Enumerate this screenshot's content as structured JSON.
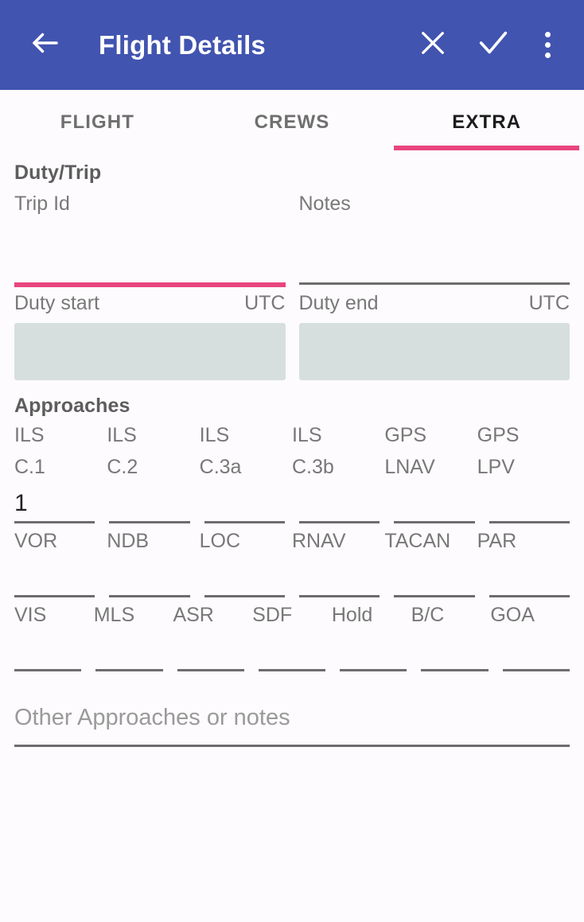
{
  "colors": {
    "appbar": "#4154b0",
    "accent_pink": "#e8457e",
    "background": "#fdfbfd",
    "date_box": "#d6dfde",
    "underline": "#6d6d6d",
    "label_text": "#787878",
    "section_title": "#5d5d5d"
  },
  "appbar": {
    "back_icon": "back-arrow-icon",
    "title": "Flight Details",
    "actions": [
      {
        "icon": "close-icon",
        "name": "discard-button"
      },
      {
        "icon": "check-icon",
        "name": "save-button"
      },
      {
        "icon": "overflow-menu-icon",
        "name": "overflow-menu-button"
      }
    ]
  },
  "tabs": [
    {
      "label": "FLIGHT",
      "active": false
    },
    {
      "label": "CREWS",
      "active": false
    },
    {
      "label": "EXTRA",
      "active": true
    }
  ],
  "duty_trip": {
    "section_title": "Duty/Trip",
    "trip_id": {
      "label": "Trip Id",
      "value": "",
      "focused": true
    },
    "notes": {
      "label": "Notes",
      "value": "",
      "focused": false
    },
    "duty_start": {
      "label": "Duty start",
      "suffix": "UTC",
      "value": ""
    },
    "duty_end": {
      "label": "Duty end",
      "suffix": "UTC",
      "value": ""
    }
  },
  "approaches": {
    "section_title": "Approaches",
    "rows": [
      {
        "cells": [
          {
            "line1": "ILS",
            "line2": "C.1",
            "value": "1"
          },
          {
            "line1": "ILS",
            "line2": "C.2",
            "value": ""
          },
          {
            "line1": "ILS",
            "line2": "C.3a",
            "value": ""
          },
          {
            "line1": "ILS",
            "line2": "C.3b",
            "value": ""
          },
          {
            "line1": "GPS",
            "line2": "LNAV",
            "value": ""
          },
          {
            "line1": "GPS",
            "line2": "LPV",
            "value": ""
          }
        ]
      },
      {
        "cells": [
          {
            "line1": "VOR",
            "line2": "",
            "value": ""
          },
          {
            "line1": "NDB",
            "line2": "",
            "value": ""
          },
          {
            "line1": "LOC",
            "line2": "",
            "value": ""
          },
          {
            "line1": "RNAV",
            "line2": "",
            "value": ""
          },
          {
            "line1": "TACAN",
            "line2": "",
            "value": ""
          },
          {
            "line1": "PAR",
            "line2": "",
            "value": ""
          }
        ]
      },
      {
        "cells": [
          {
            "line1": "VIS",
            "line2": "",
            "value": ""
          },
          {
            "line1": "MLS",
            "line2": "",
            "value": ""
          },
          {
            "line1": "ASR",
            "line2": "",
            "value": ""
          },
          {
            "line1": "SDF",
            "line2": "",
            "value": ""
          },
          {
            "line1": "Hold",
            "line2": "",
            "value": ""
          },
          {
            "line1": "B/C",
            "line2": "",
            "value": ""
          },
          {
            "line1": "GOA",
            "line2": "",
            "value": ""
          }
        ]
      }
    ],
    "other": {
      "placeholder": "Other Approaches or notes",
      "value": ""
    }
  }
}
